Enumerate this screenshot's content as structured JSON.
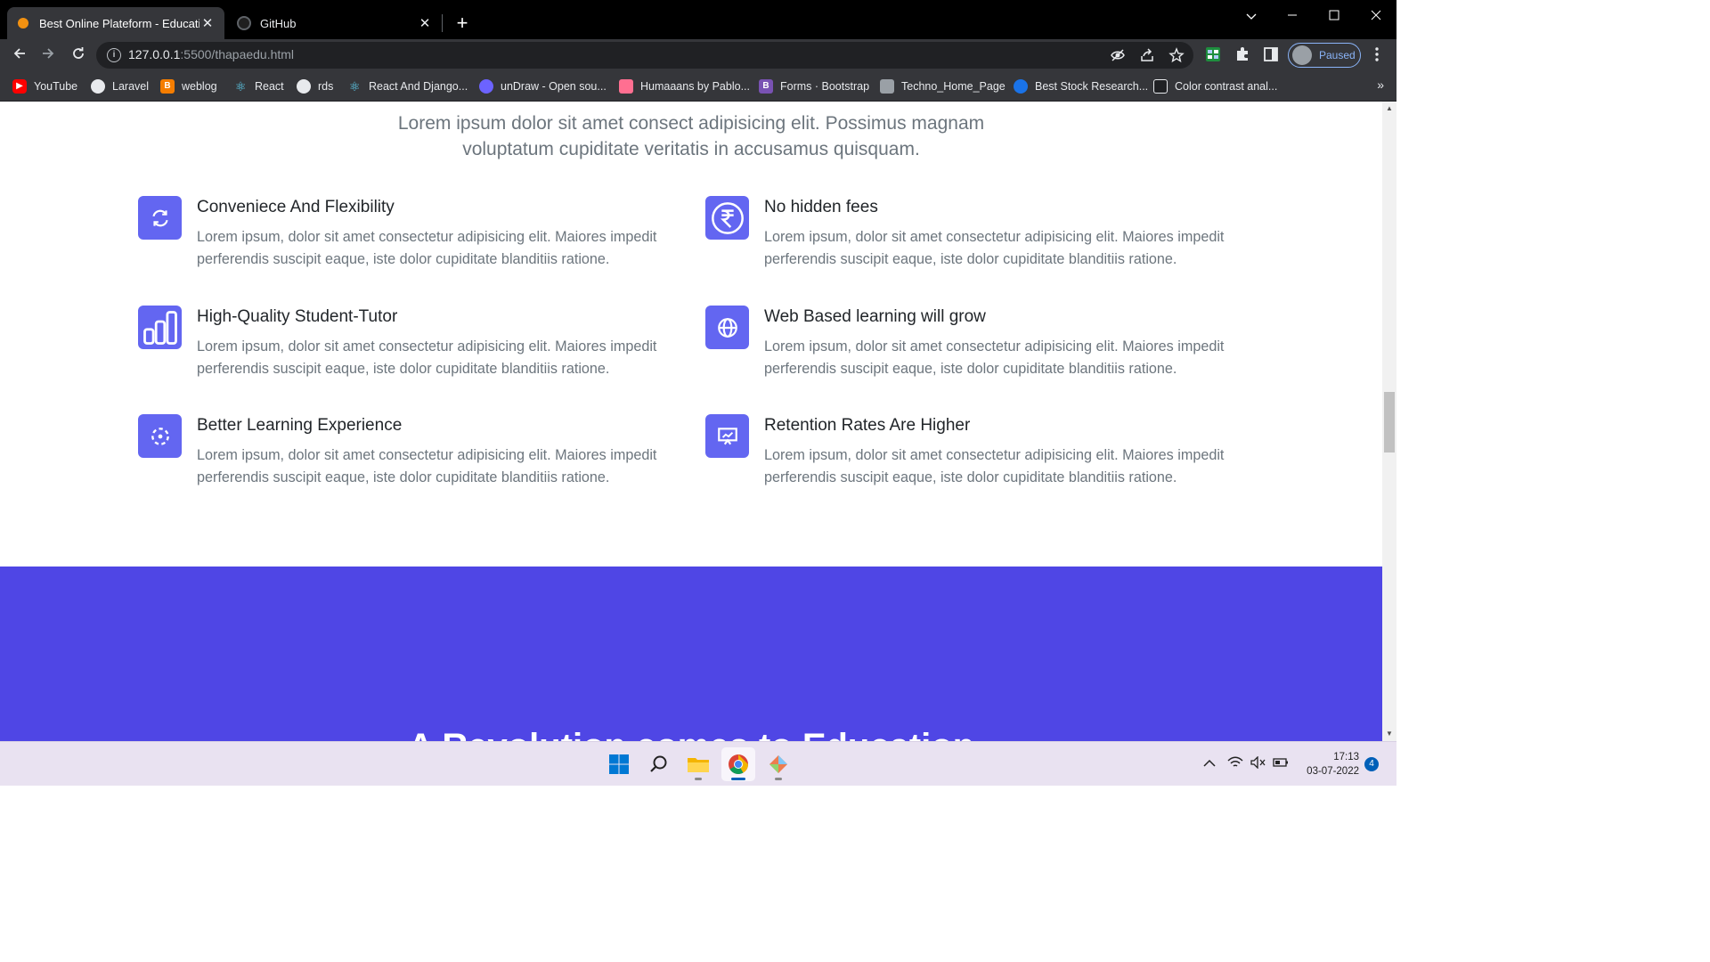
{
  "browser": {
    "tabs": [
      {
        "title": "Best Online Plateform - Education",
        "active": true
      },
      {
        "title": "GitHub",
        "active": false
      }
    ],
    "url_host": "127.0.0.1",
    "url_rest": ":5500/thapaedu.html",
    "profile_label": "Paused",
    "bookmarks": [
      {
        "label": "YouTube",
        "icon": "youtube-icon",
        "color": "#ff0000"
      },
      {
        "label": "Laravel",
        "icon": "globe-icon",
        "color": "#e8eaed"
      },
      {
        "label": "weblog",
        "icon": "blogger-icon",
        "color": "#f57d00"
      },
      {
        "label": "React",
        "icon": "react-icon",
        "color": "#61dafb"
      },
      {
        "label": "rds",
        "icon": "globe-icon",
        "color": "#e8eaed"
      },
      {
        "label": "React And Django...",
        "icon": "react-icon",
        "color": "#61dafb"
      },
      {
        "label": "unDraw - Open sou...",
        "icon": "undraw-icon",
        "color": "#6c63ff"
      },
      {
        "label": "Humaaans by Pablo...",
        "icon": "humaaans-icon",
        "color": "#ff6f91"
      },
      {
        "label": "Forms · Bootstrap",
        "icon": "bootstrap-icon",
        "color": "#7952b3"
      },
      {
        "label": "Techno_Home_Page",
        "icon": "techno-icon",
        "color": "#9aa0a6"
      },
      {
        "label": "Best Stock Research...",
        "icon": "stock-icon",
        "color": "#1a73e8"
      },
      {
        "label": "Color contrast anal...",
        "icon": "contrast-icon",
        "color": "#202124"
      }
    ]
  },
  "page": {
    "intro_line1": "Lorem ipsum dolor sit amet consect adipisicing elit. Possimus magnam",
    "intro_line2": "voluptatum cupiditate veritatis in accusamus quisquam.",
    "features": [
      {
        "title": "Conveniece And Flexibility",
        "desc": "Lorem ipsum, dolor sit amet consectetur adipisicing elit. Maiores impedit perferendis suscipit eaque, iste dolor cupiditate blanditiis ratione.",
        "icon": "refresh-icon"
      },
      {
        "title": "No hidden fees",
        "desc": "Lorem ipsum, dolor sit amet consectetur adipisicing elit. Maiores impedit perferendis suscipit eaque, iste dolor cupiditate blanditiis ratione.",
        "icon": "rupee-icon"
      },
      {
        "title": "High-Quality Student-Tutor",
        "desc": "Lorem ipsum, dolor sit amet consectetur adipisicing elit. Maiores impedit perferendis suscipit eaque, iste dolor cupiditate blanditiis ratione.",
        "icon": "bar-chart-icon"
      },
      {
        "title": "Web Based learning will grow",
        "desc": "Lorem ipsum, dolor sit amet consectetur adipisicing elit. Maiores impedit perferendis suscipit eaque, iste dolor cupiditate blanditiis ratione.",
        "icon": "globe-icon"
      },
      {
        "title": "Better Learning Experience",
        "desc": "Lorem ipsum, dolor sit amet consectetur adipisicing elit. Maiores impedit perferendis suscipit eaque, iste dolor cupiditate blanditiis ratione.",
        "icon": "focus-icon"
      },
      {
        "title": "Retention Rates Are Higher",
        "desc": "Lorem ipsum, dolor sit amet consectetur adipisicing elit. Maiores impedit perferendis suscipit eaque, iste dolor cupiditate blanditiis ratione.",
        "icon": "presentation-chart-icon"
      }
    ],
    "banner_title": "A Revolution comes to Education",
    "accent_color": "#6366f1",
    "banner_color": "#4f46e5"
  },
  "taskbar": {
    "time": "17:13",
    "date": "03-07-2022",
    "notification_count": "4"
  }
}
